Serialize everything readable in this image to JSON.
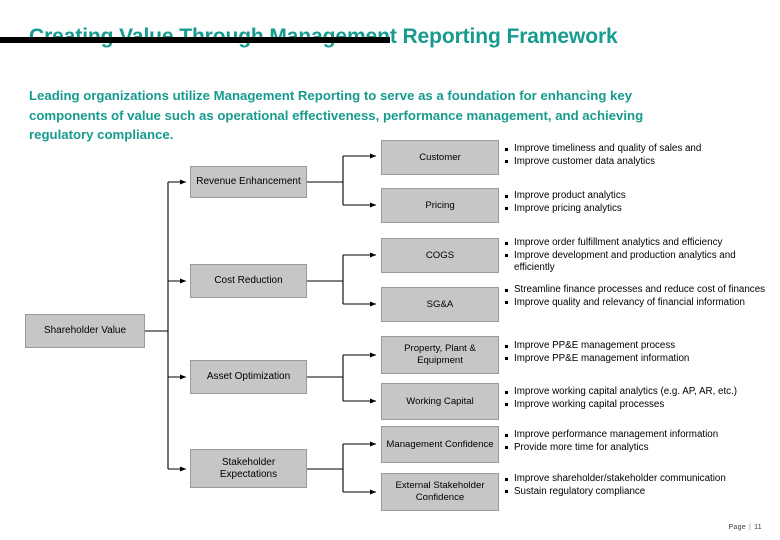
{
  "header": {
    "title": "Creating Value Through Management Reporting Framework",
    "subtitle": "Leading organizations utilize Management Reporting to serve as a foundation for enhancing key components of value such as operational effectiveness, performance management, and achieving regulatory compliance.",
    "accent_color": "#179b8e",
    "rule_color": "#000000"
  },
  "diagram": {
    "node_fill": "#c6c6c6",
    "node_border": "#9a9a9a",
    "connector_color": "#000000",
    "root": {
      "label": "Shareholder Value"
    },
    "branches": [
      {
        "label": "Revenue Enhancement",
        "leaves": [
          {
            "label": "Customer",
            "bullets": [
              "Improve timeliness and quality of sales and",
              "Improve customer data analytics"
            ]
          },
          {
            "label": "Pricing",
            "bullets": [
              "Improve product analytics",
              "Improve pricing analytics"
            ]
          }
        ]
      },
      {
        "label": "Cost Reduction",
        "leaves": [
          {
            "label": "COGS",
            "bullets": [
              "Improve order fulfillment analytics and efficiency",
              "Improve development and production analytics and efficiently"
            ]
          },
          {
            "label": "SG&A",
            "bullets": [
              "Streamline finance processes and reduce cost of finances",
              "Improve quality and relevancy of financial information"
            ]
          }
        ]
      },
      {
        "label": "Asset Optimization",
        "leaves": [
          {
            "label": "Property, Plant & Equipment",
            "bullets": [
              "Improve PP&E management process",
              "Improve PP&E management information"
            ]
          },
          {
            "label": "Working Capital",
            "bullets": [
              "Improve working capital analytics (e.g. AP, AR, etc.)",
              "Improve working capital processes"
            ]
          }
        ]
      },
      {
        "label": "Stakeholder Expectations",
        "leaves": [
          {
            "label": "Management Confidence",
            "bullets": [
              "Improve performance management information",
              "Provide more time for analytics"
            ]
          },
          {
            "label": "External Stakeholder Confidence",
            "bullets": [
              "Improve shareholder/stakeholder communication",
              "Sustain regulatory compliance"
            ]
          }
        ]
      }
    ]
  },
  "footer": {
    "page_label": "Page",
    "separator": "|",
    "page_number": "11"
  }
}
